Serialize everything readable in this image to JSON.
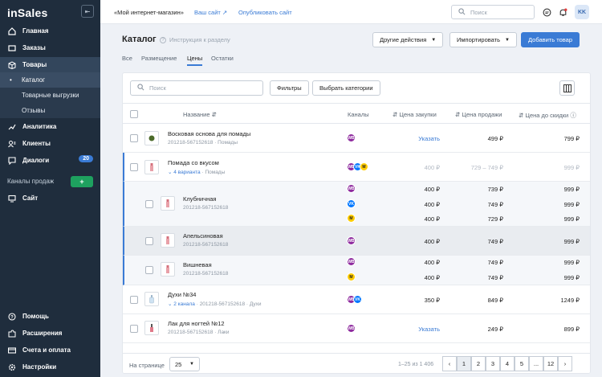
{
  "brand": {
    "logo": "inSales",
    "accent": "#3a7bd5",
    "sidebar_bg": "#1f2d3d",
    "add_green": "#1ea15f"
  },
  "sidebar": {
    "collapse_icon": "collapse-left-icon",
    "items": [
      {
        "label": "Главная",
        "icon": "home-icon"
      },
      {
        "label": "Заказы",
        "icon": "cart-icon"
      },
      {
        "label": "Товары",
        "icon": "box-icon"
      },
      {
        "label": "Аналитика",
        "icon": "chart-icon"
      },
      {
        "label": "Клиенты",
        "icon": "users-icon"
      },
      {
        "label": "Диалоги",
        "icon": "chat-icon",
        "badge": "20"
      },
      {
        "label": "Сайт",
        "icon": "monitor-icon"
      }
    ],
    "subitems": [
      {
        "label": "Каталог"
      },
      {
        "label": "Товарные выгрузки"
      },
      {
        "label": "Отзывы"
      }
    ],
    "sales_channels_label": "Каналы продаж",
    "sales_channels_add": "+",
    "bottom": [
      {
        "label": "Помощь",
        "icon": "help-icon"
      },
      {
        "label": "Расширения",
        "icon": "puzzle-icon"
      },
      {
        "label": "Счета и оплата",
        "icon": "card-icon"
      },
      {
        "label": "Настройки",
        "icon": "settings-icon"
      }
    ]
  },
  "topbar": {
    "store_name": "«Мой интернет-магазин»",
    "your_site": "Ваш сайт",
    "publish": "Опубликовать сайт",
    "search_placeholder": "Поиск",
    "avatar": "KK"
  },
  "page": {
    "title": "Каталог",
    "hint": "Инструкция к разделу",
    "actions": {
      "other": "Другие действия",
      "import": "Импортировать",
      "add": "Добавить товар"
    },
    "tabs": [
      "Все",
      "Размещение",
      "Цены",
      "Остатки"
    ],
    "active_tab": "Цены"
  },
  "table": {
    "search_placeholder": "Поиск",
    "filters": "Фильтры",
    "choose_categories": "Выбрать категории",
    "columns": {
      "name": "Название",
      "channels": "Каналы",
      "purchase": "Цена закупки",
      "sale": "Цена продажи",
      "before_discount": "Цена до скидки"
    },
    "rows": [
      {
        "name": "Восковая основа для помады",
        "meta": "201218-567152618",
        "category": "Помады",
        "channels": [
          "WB"
        ],
        "purchase": "Указать",
        "sale": "499 ₽",
        "old": "799 ₽"
      },
      {
        "name": "Помада со вкусом",
        "variants": "4 варианта",
        "category": "Помады",
        "channels": [
          "WB",
          "VK",
          "YM"
        ],
        "purchase": "400 ₽",
        "sale": "729 – 749 ₽",
        "old": "999 ₽"
      },
      {
        "name": "Клубничная",
        "meta": "201218-567152618",
        "prices": [
          {
            "channel": "WB",
            "purchase": "400 ₽",
            "sale": "739 ₽",
            "old": "999 ₽"
          },
          {
            "channel": "VK",
            "purchase": "400 ₽",
            "sale": "749 ₽",
            "old": "999 ₽"
          },
          {
            "channel": "YM",
            "purchase": "400 ₽",
            "sale": "729 ₽",
            "old": "999 ₽"
          }
        ]
      },
      {
        "name": "Апельсиновая",
        "meta": "201218-567152618",
        "prices": [
          {
            "channel": "WB",
            "purchase": "400 ₽",
            "sale": "749 ₽",
            "old": "999 ₽"
          }
        ]
      },
      {
        "name": "Вишневая",
        "meta": "201218-567152618",
        "prices": [
          {
            "channel": "WB",
            "purchase": "400 ₽",
            "sale": "749 ₽",
            "old": "999 ₽"
          },
          {
            "channel": "YM",
            "purchase": "400 ₽",
            "sale": "749 ₽",
            "old": "999 ₽"
          }
        ]
      },
      {
        "name": "Духи №34",
        "variants": "2 канала",
        "meta": "201218-567152618",
        "category": "Духи",
        "channels": [
          "WB",
          "VK"
        ],
        "purchase": "350 ₽",
        "sale": "849 ₽",
        "old": "1249 ₽"
      },
      {
        "name": "Лак для ногтей №12",
        "meta": "201218-567152618",
        "category": "Лаки",
        "channels": [
          "WB"
        ],
        "purchase": "Указать",
        "sale": "249 ₽",
        "old": "899 ₽"
      }
    ]
  },
  "footer": {
    "per_page_label": "На странице",
    "per_page": "25",
    "range": "1–25 из 1 406",
    "pages": [
      "1",
      "2",
      "3",
      "4",
      "5",
      "...",
      "12"
    ],
    "current_page": "1"
  }
}
